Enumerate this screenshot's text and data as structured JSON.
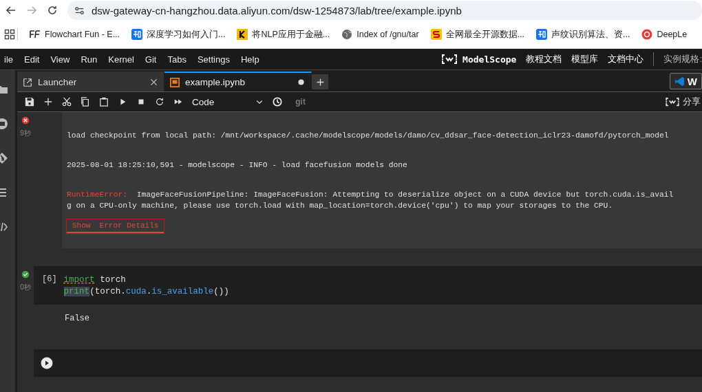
{
  "browser": {
    "url": "dsw-gateway-cn-hangzhou.data.aliyun.com/dsw-1254873/lab/tree/example.ipynb",
    "bookmarks": [
      {
        "kind": "ff",
        "label": "Flowchart Fun - E..."
      },
      {
        "kind": "zhi",
        "label": "深度学习如何入门..."
      },
      {
        "kind": "k",
        "label": "将NLP应用于金融..."
      },
      {
        "kind": "globe",
        "label": "Index of /gnu/tar"
      },
      {
        "kind": "s",
        "label": "全网最全开源数据..."
      },
      {
        "kind": "zhi",
        "label": "声纹识别算法、资..."
      },
      {
        "kind": "deepl",
        "label": "DeepLe"
      }
    ]
  },
  "menubar": {
    "items": [
      "ile",
      "Edit",
      "View",
      "Run",
      "Kernel",
      "Git",
      "Tabs",
      "Settings",
      "Help"
    ],
    "brand": "ModelScope",
    "links": [
      "教程文档",
      "模型库",
      "文档中心"
    ],
    "spec_label": "实例规格:"
  },
  "tabs": [
    {
      "label": "Launcher",
      "kind": "launcher",
      "selected": false
    },
    {
      "label": "example.ipynb",
      "kind": "notebook",
      "selected": true,
      "unsaved": true
    }
  ],
  "vscode_button": "W",
  "toolbar": {
    "cell_type": "Code",
    "git": "git",
    "share": "分享"
  },
  "cells": [
    {
      "kind": "error",
      "time": "9秒",
      "outputs": [
        {
          "kind": "line",
          "segments": [
            {
              "kind": "plain",
              "text": "load checkpoint from local path: /mnt/workspace/.cache/modelscope/models/damo/cv_ddsar_face-detection_iclr23-damofd/pytorch_model"
            }
          ]
        },
        {
          "kind": "line",
          "segments": [
            {
              "kind": "plain",
              "text": "2025-08-01 18:25:10,591 - modelscope - INFO - load facefusion models done"
            }
          ]
        },
        {
          "kind": "error",
          "segments": [
            {
              "kind": "error-name",
              "text": "RuntimeError:"
            },
            {
              "kind": "plain",
              "text": "  ImageFaceFusionPipeline: ImageFaceFusion: Attempting to deserialize object on a CUDA device but torch.cuda.is_avail"
            }
          ]
        },
        {
          "kind": "continuation",
          "segments": [
            {
              "kind": "plain",
              "text": "g on a CPU-only machine, please use torch.load with map_location=torch.device('cpu') to map your storages to the CPU."
            }
          ]
        },
        {
          "kind": "button",
          "label": "Show  Error Details"
        }
      ]
    },
    {
      "kind": "ok",
      "time": "0秒",
      "prompt": "[6]",
      "code": [
        [
          {
            "kind": "keyword",
            "text": "import"
          },
          {
            "kind": "plain",
            "text": " torch"
          }
        ],
        [
          {
            "kind": "builtin",
            "text": "print"
          },
          {
            "kind": "plain",
            "text": "(torch."
          },
          {
            "kind": "attr",
            "text": "cuda"
          },
          {
            "kind": "plain",
            "text": "."
          },
          {
            "kind": "attr",
            "text": "is_available"
          },
          {
            "kind": "plain",
            "text": "())"
          }
        ]
      ],
      "outputs": [
        {
          "kind": "result",
          "segments": [
            {
              "kind": "plain",
              "text": "False"
            }
          ]
        }
      ]
    },
    {
      "kind": "empty"
    }
  ]
}
